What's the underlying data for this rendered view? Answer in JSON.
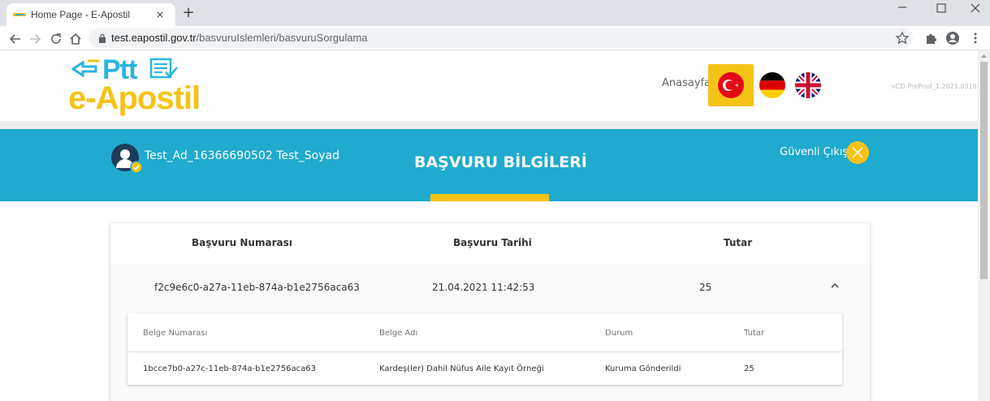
{
  "browser": {
    "tab_title": "Home Page - E-Apostil",
    "tab_close": "×",
    "new_tab": "+",
    "url_host": "test.eapostil.gov.tr",
    "url_path": "/basvuruIslemleri/basvuruSorgulama"
  },
  "header": {
    "logo_ptt": "Ptt",
    "logo_name": "e-Apostil",
    "home_link": "Anasayfa",
    "version": "vCD-PreProd_1.2021.0316.1",
    "languages": [
      "tr-flag-icon",
      "de-flag-icon",
      "uk-flag-icon"
    ]
  },
  "banner": {
    "user_name": "Test_Ad_16366690502 Test_Soyad",
    "title": "BAŞVURU BİLGİLERİ",
    "logout_label": "Güvenli Çıkış"
  },
  "application_table": {
    "headers": {
      "number": "Başvuru Numarası",
      "date": "Başvuru Tarihi",
      "amount": "Tutar"
    },
    "rows": [
      {
        "number": "f2c9e6c0-a27a-11eb-874a-b1e2756aca63",
        "date": "21.04.2021 11:42:53",
        "amount": "25",
        "expanded": true,
        "documents": {
          "headers": {
            "number": "Belge Numarası",
            "name": "Belge Adı",
            "status": "Durum",
            "amount": "Tutar"
          },
          "rows": [
            {
              "number": "1bcce7b0-a27c-11eb-874a-b1e2756aca63",
              "name": "Kardeş(ler) Dahil Nüfus Aile Kayıt Örneği",
              "status": "Kuruma Gönderildi",
              "amount": "25"
            }
          ]
        }
      }
    ]
  },
  "colors": {
    "banner": "#1faace",
    "accent": "#f5c316",
    "logo_blue": "#29b4e0"
  }
}
